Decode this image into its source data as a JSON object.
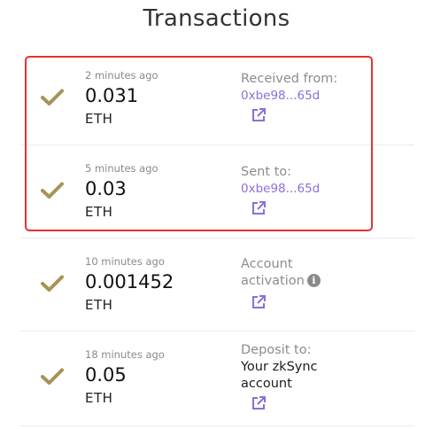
{
  "page_title": "Transactions",
  "colors": {
    "check": "#a89256",
    "link": "#8b6fdb",
    "highlight_border": "#e4322f"
  },
  "transactions": [
    {
      "time": "2 minutes ago",
      "amount": "0.031",
      "token": "ETH",
      "label": "Received from:",
      "address": "0xbe98...65d",
      "status_icon": "check-icon",
      "link_icon": "external-link-icon"
    },
    {
      "time": "5 minutes ago",
      "amount": "0.03",
      "token": "ETH",
      "label": "Sent to:",
      "address": "0xbe98...65d",
      "status_icon": "check-icon",
      "link_icon": "external-link-icon"
    },
    {
      "time": "10 minutes ago",
      "amount": "0.001452",
      "token": "ETH",
      "label_line1": "Account",
      "label_line2": "activation",
      "status_icon": "check-icon",
      "info_icon": "info-icon",
      "info_glyph": "i",
      "link_icon": "external-link-icon"
    },
    {
      "time": "18 minutes ago",
      "amount": "0.05",
      "token": "ETH",
      "label": "Deposit to:",
      "detail_line1": "Your zkSync",
      "detail_line2": "account",
      "status_icon": "check-icon",
      "link_icon": "external-link-icon"
    }
  ]
}
